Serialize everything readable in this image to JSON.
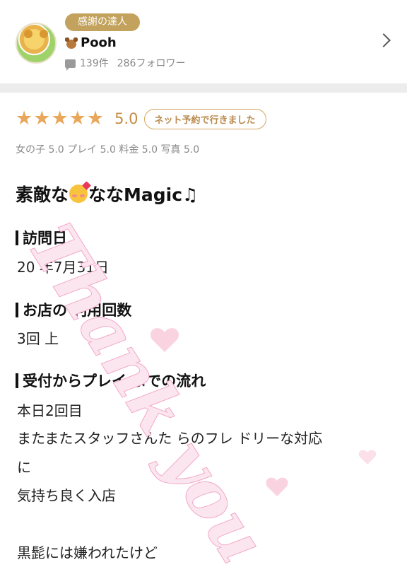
{
  "profile": {
    "badge": "感謝の達人",
    "username": "Pooh",
    "review_count": "139件",
    "followers": "286フォロワー",
    "avatar_icon": "pooh-avatar-icon",
    "user_icon": "teddy-bear-icon"
  },
  "review": {
    "stars": 5,
    "score": "5.0",
    "booking_badge": "ネット予約で行きました",
    "sub_scores": "女の子 5.0 プレイ 5.0 料金 5.0 写真 5.0",
    "title_prefix": "素敵な",
    "title_suffix": "ななMagic♫",
    "sections": {
      "visit_date": {
        "heading": "訪問日",
        "value": "20  年7月31日"
      },
      "usage_count": {
        "heading": "お店の 利用回数",
        "value": "3回 上"
      },
      "flow": {
        "heading": "受付からプレイ  までの流れ",
        "lines": [
          "本日2回目",
          "またまたスタッフさんた らのフレ  ドリーな対応",
          "に",
          "気持ち良く入店",
          "",
          "黒髭には嫌われたけど"
        ]
      }
    }
  },
  "overlay": {
    "text": "Thank you"
  },
  "colors": {
    "gold": "#c2a25c",
    "star": "#e8a75a",
    "watermark_pink": "#f3a6c6"
  }
}
